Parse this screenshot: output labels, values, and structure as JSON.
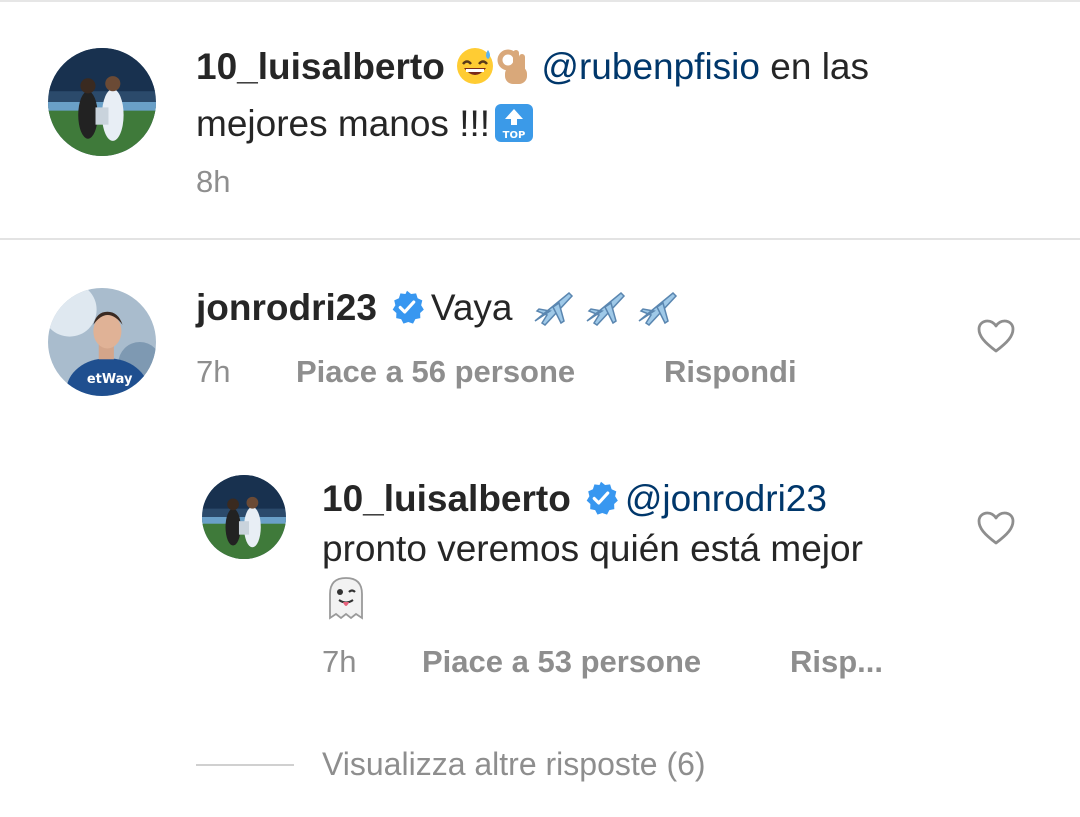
{
  "comments": [
    {
      "username": "10_luisalberto",
      "emojis": [
        "grinning-sweat-emoji",
        "ok-hand-emoji"
      ],
      "mention": "@rubenpfisio",
      "text_inline": "en las",
      "text_line2": "mejores manos !!!",
      "trailing_emoji": "top-arrow-emoji",
      "top_emoji_label": "TOP",
      "time": "8h"
    },
    {
      "username": "jonrodri23",
      "verified": true,
      "text": "Vaya",
      "emoji": "airplane-emoji",
      "emoji_count": 3,
      "time": "7h",
      "likes": "Piace a 56 persone",
      "reply_label": "Rispondi"
    }
  ],
  "reply": {
    "username": "10_luisalberto",
    "verified": true,
    "mention": "@jonrodri23",
    "text": "pronto veremos quién está mejor",
    "emoji": "ghost-emoji",
    "time": "7h",
    "likes": "Piace a 53 persone",
    "reply_label": "Risp..."
  },
  "view_more": "Visualizza altre risposte (6)",
  "colors": {
    "text": "#262626",
    "muted": "#8e8e8e",
    "mention": "#00376b",
    "verified": "#3897f0",
    "divider": "#e3e3e3"
  }
}
